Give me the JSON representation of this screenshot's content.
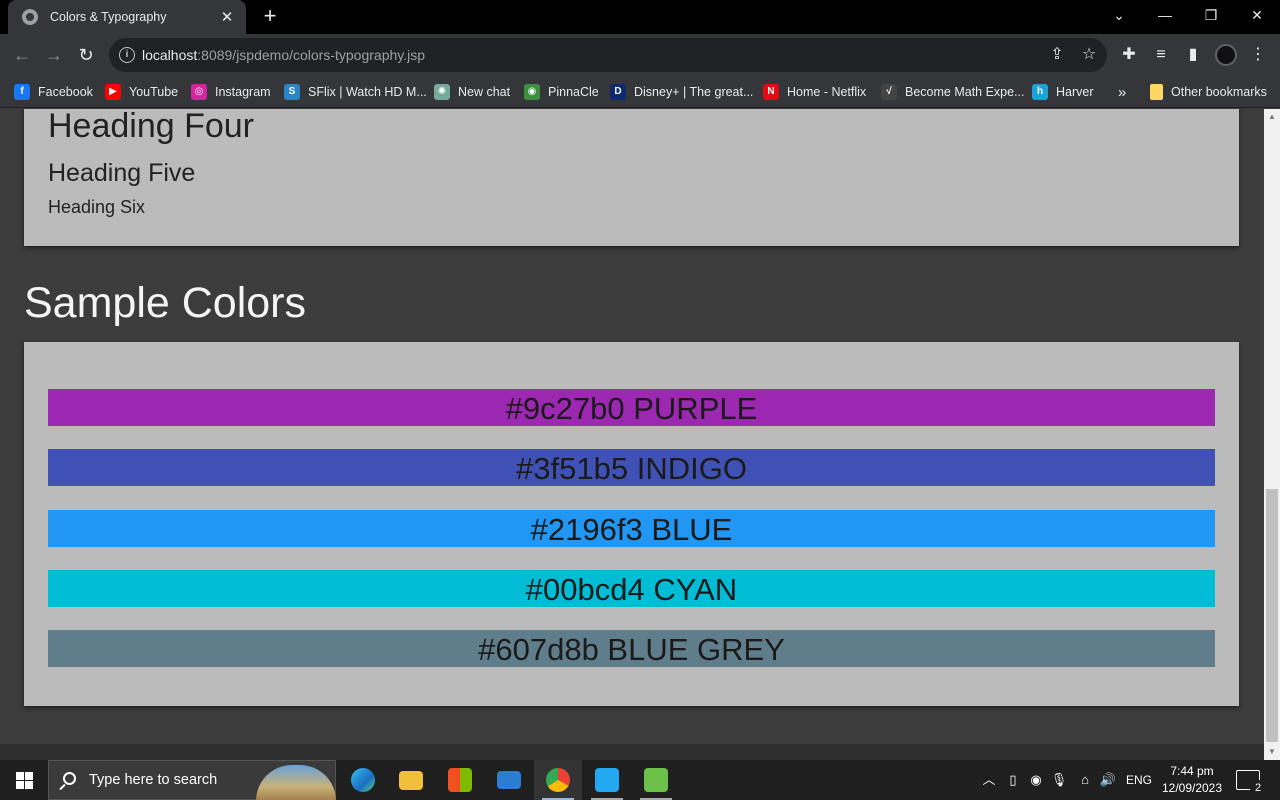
{
  "browser": {
    "tab": {
      "title": "Colors & Typography",
      "close": "✕"
    },
    "new_tab": "+",
    "window_controls": {
      "dropdown": "⌄",
      "minimize": "—",
      "restore": "❐",
      "close": "✕"
    },
    "nav": {
      "back": "←",
      "forward": "→",
      "reload": "↻"
    },
    "address": {
      "host": "localhost",
      "path": ":8089/jspdemo/colors-typography.jsp"
    },
    "bookmarks": [
      {
        "label": "Facebook",
        "color": "#1877f2",
        "glyph": "f"
      },
      {
        "label": "YouTube",
        "color": "#ff0000",
        "glyph": "▶"
      },
      {
        "label": "Instagram",
        "color": "#d6249f",
        "glyph": "◎"
      },
      {
        "label": "SFlix | Watch HD M...",
        "color": "#2a84c6",
        "glyph": "S"
      },
      {
        "label": "New chat",
        "color": "#74aa9c",
        "glyph": "✺"
      },
      {
        "label": "PinnaCle",
        "color": "#3c8f3c",
        "glyph": "◉"
      },
      {
        "label": "Disney+ | The great...",
        "color": "#0d2a6e",
        "glyph": "D"
      },
      {
        "label": "Home - Netflix",
        "color": "#e50914",
        "glyph": "N"
      },
      {
        "label": "Become Math Expe...",
        "color": "#444444",
        "glyph": "√"
      },
      {
        "label": "Harver",
        "color": "#1aa3d9",
        "glyph": "h"
      }
    ],
    "bookmarks_overflow": "»",
    "other_bookmarks": "Other bookmarks"
  },
  "page": {
    "headings": {
      "h4": "Heading Four",
      "h5": "Heading Five",
      "h6": "Heading Six"
    },
    "section_title": "Sample Colors",
    "swatches": [
      {
        "label": "#9c27b0 PURPLE",
        "color": "#9c27b0"
      },
      {
        "label": "#3f51b5 INDIGO",
        "color": "#3f51b5"
      },
      {
        "label": "#2196f3 BLUE",
        "color": "#2196f3"
      },
      {
        "label": "#00bcd4 CYAN",
        "color": "#00bcd4"
      },
      {
        "label": "#607d8b BLUE GREY",
        "color": "#607d8b"
      }
    ],
    "scroll_position": 0.77
  },
  "taskbar": {
    "search_placeholder": "Type here to search",
    "language": "ENG",
    "time": "7:44 pm",
    "date": "12/09/2023",
    "notification_count": "2"
  }
}
